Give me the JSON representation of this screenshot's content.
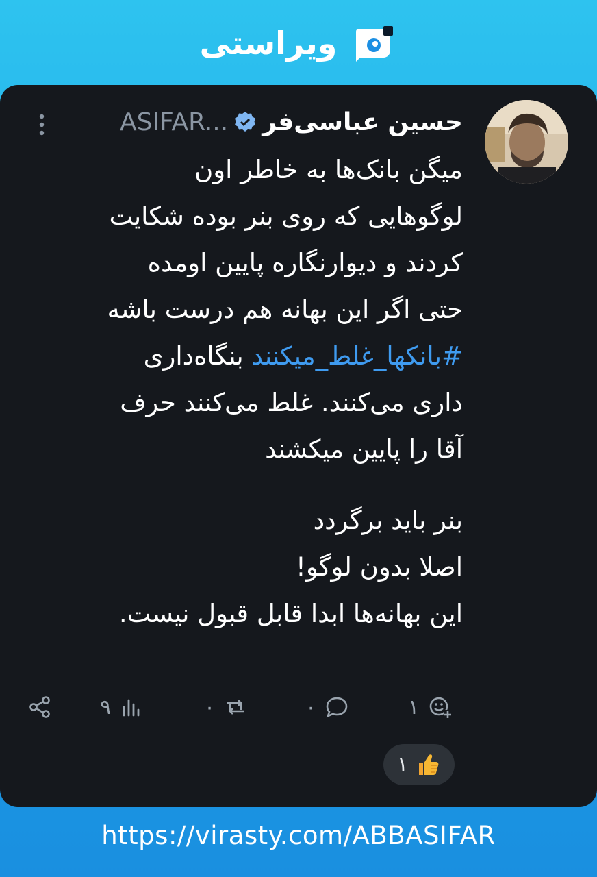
{
  "header": {
    "brand": "ویراستی",
    "logo_icon": "virasty-logo-icon"
  },
  "post": {
    "display_name": "حسین عباسی‌فر",
    "handle": "ASIFAR...",
    "verified_icon": "verified-badge-icon",
    "more_icon": "more-vertical-icon",
    "lines": [
      "میگن بانک‌ها به خاطر اون",
      "لوگوهایی که روی بنر بوده شکایت",
      "کردند و دیوارنگاره پایین اومده",
      "حتی اگر این بهانه هم درست باشه"
    ],
    "hashtag": "#بانکها_غلط_میکنند",
    "hashtag_line_rest": "بنگاه‌داری",
    "lines_after": [
      "داری می‌کنند. غلط می‌کنند حرف",
      "آقا را پایین میکشند"
    ],
    "lines_end": [
      "بنر باید برگردد",
      "اصلا بدون لوگو!",
      "این بهانه‌ها ابدا قابل قبول نیست."
    ]
  },
  "actions": {
    "reactions_count": "۱",
    "comments_count": "۰",
    "reposts_count": "۰",
    "views_count": "۹",
    "reaction_emoji": "👍",
    "reaction_pill_count": "۱"
  },
  "footer": {
    "url": "https://virasty.com/ABBASIFAR"
  },
  "colors": {
    "accent": "#3f9bf0",
    "card": "#15181d",
    "header": "#2ec3ef"
  }
}
